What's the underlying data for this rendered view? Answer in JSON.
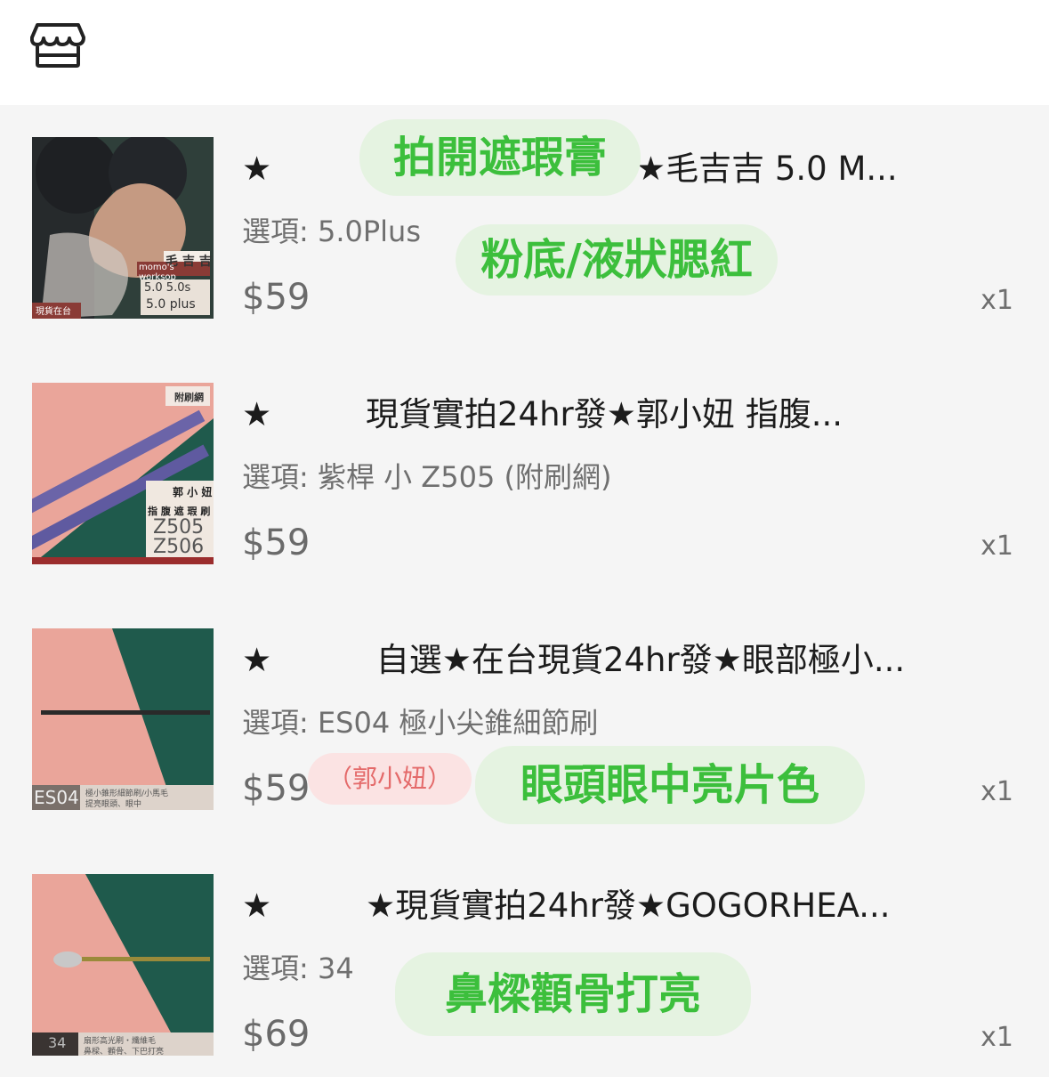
{
  "header": {
    "shop_icon": "storefront-icon"
  },
  "items": [
    {
      "title": "★         ★在台現貨24hr發★毛吉吉 5.0 M...",
      "option": "選項: 5.0Plus",
      "price": "$59",
      "qty": "x1",
      "tag": "粉底/液狀腮紅",
      "thumb": {
        "brand": "毛 吉 吉",
        "label": "momo's worksop",
        "models": "5.0  5.0s",
        "models2": "5.0 plus",
        "stock": "現貨在台"
      }
    },
    {
      "title": "★         現貨實拍24hr發★郭小妞 指腹...",
      "option": "選項: 紫桿 小 Z505 (附刷網)",
      "price": "$59",
      "qty": "x1",
      "tag": "拍開遮瑕膏",
      "thumb": {
        "badge": "附刷網",
        "brand": "郭 小 妞",
        "name": "指 腹 遮 瑕 刷",
        "m1": "Z505",
        "m2": "Z506"
      }
    },
    {
      "title": "★          自選★在台現貨24hr發★眼部極小...",
      "option": "選項: ES04 極小尖錐細節刷",
      "price": "$59",
      "qty": "x1",
      "pink_tag": "（郭小妞）",
      "tag": "眼頭眼中亮片色",
      "thumb": {
        "code": "ES04",
        "desc": "極小錐形細節刷/小馬毛",
        "desc2": "提亮眼頭、眼中"
      }
    },
    {
      "title": "★         ★現貨實拍24hr發★GOGORHEA...",
      "option": "選項: 34",
      "price": "$69",
      "qty": "x1",
      "tag": "鼻樑顴骨打亮",
      "thumb": {
        "code": "34",
        "desc": "扇形高光刷・纖維毛",
        "desc2": "鼻樑、顴骨、下巴打亮"
      }
    }
  ],
  "colors": {
    "tag_green_bg": "#e5f3e1",
    "tag_green_text": "#3cbf3c",
    "tag_pink_bg": "#fbe3e3",
    "tag_pink_text": "#e46a6a"
  }
}
